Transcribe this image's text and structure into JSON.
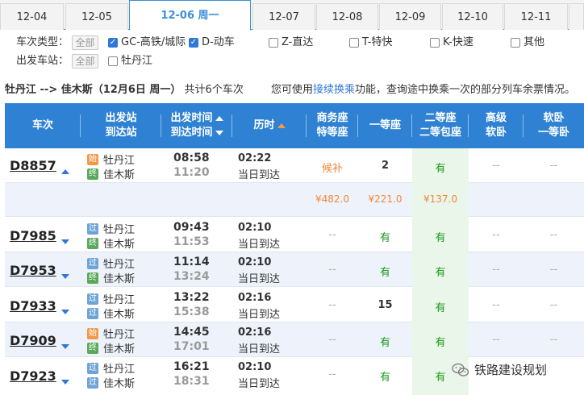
{
  "date_tabs": [
    {
      "label": "12-04"
    },
    {
      "label": "12-05"
    },
    {
      "label": "12-06 周一"
    },
    {
      "label": "12-07"
    },
    {
      "label": "12-08"
    },
    {
      "label": "12-09"
    },
    {
      "label": "12-10"
    },
    {
      "label": "12-11"
    }
  ],
  "active_tab_index": 2,
  "filters": {
    "type_label": "车次类型：",
    "all_label": "全部",
    "types": [
      {
        "label": "GC-高铁/城际",
        "checked": true
      },
      {
        "label": "D-动车",
        "checked": true
      },
      {
        "label": "Z-直达",
        "checked": false
      },
      {
        "label": "T-特快",
        "checked": false
      },
      {
        "label": "K-快速",
        "checked": false
      },
      {
        "label": "其他",
        "checked": false
      }
    ],
    "station_label": "出发车站：",
    "station_all_label": "全部",
    "stations": [
      {
        "label": "牡丹江",
        "checked": false
      }
    ]
  },
  "summary": {
    "route": "牡丹江 --> 佳木斯（12月6日 周一）",
    "count": "共计6个车次",
    "tip_prefix": "您可使用",
    "tip_link": "接续换乘",
    "tip_suffix": "功能，查询途中换乘一次的部分列车余票情况。"
  },
  "table": {
    "headers": {
      "train": "车次",
      "station_top": "出发站",
      "station_bottom": "到达站",
      "time_top": "出发时间",
      "time_bottom": "到达时间",
      "duration": "历时",
      "business_top": "商务座",
      "business_bottom": "特等座",
      "first": "一等座",
      "second_top": "二等座",
      "second_bottom": "二等包座",
      "soft_sleeper_top": "高级",
      "soft_sleeper_bottom": "软卧",
      "soft_first_top": "软卧",
      "soft_first_bottom": "一等卧"
    },
    "rows": [
      {
        "train": "D8857",
        "from_badge": "始",
        "from": "牡丹江",
        "to_badge": "终",
        "to": "佳木斯",
        "dep": "08:58",
        "arr": "11:20",
        "duration": "02:22",
        "note": "当日到达",
        "business": "候补",
        "first": "2",
        "second": "有",
        "adv_soft": "--",
        "soft_first": "--"
      },
      {
        "train": "D7985",
        "from_badge": "过",
        "from": "牡丹江",
        "to_badge": "终",
        "to": "佳木斯",
        "dep": "09:43",
        "arr": "11:53",
        "duration": "02:10",
        "note": "当日到达",
        "business": "--",
        "first": "有",
        "second": "有",
        "adv_soft": "--",
        "soft_first": "--"
      },
      {
        "train": "D7953",
        "from_badge": "过",
        "from": "牡丹江",
        "to_badge": "终",
        "to": "佳木斯",
        "dep": "11:14",
        "arr": "13:24",
        "duration": "02:10",
        "note": "当日到达",
        "business": "--",
        "first": "有",
        "second": "有",
        "adv_soft": "--",
        "soft_first": "--"
      },
      {
        "train": "D7933",
        "from_badge": "过",
        "from": "牡丹江",
        "to_badge": "过",
        "to": "佳木斯",
        "dep": "13:22",
        "arr": "15:38",
        "duration": "02:16",
        "note": "当日到达",
        "business": "--",
        "first": "15",
        "second": "有",
        "adv_soft": "--",
        "soft_first": "--"
      },
      {
        "train": "D7909",
        "from_badge": "始",
        "from": "牡丹江",
        "to_badge": "终",
        "to": "佳木斯",
        "dep": "14:45",
        "arr": "17:01",
        "duration": "02:16",
        "note": "当日到达",
        "business": "--",
        "first": "有",
        "second": "有",
        "adv_soft": "--",
        "soft_first": "--"
      },
      {
        "train": "D7923",
        "from_badge": "过",
        "from": "牡丹江",
        "to_badge": "过",
        "to": "佳木斯",
        "dep": "16:21",
        "arr": "18:31",
        "duration": "02:10",
        "note": "当日到达",
        "business": "--",
        "first": "有",
        "second": "有",
        "adv_soft": "--",
        "soft_first": "--"
      }
    ],
    "price_row": {
      "business": "¥482.0",
      "first": "¥221.0",
      "second": "¥137.0"
    }
  },
  "watermark": {
    "text": "铁路建设规划",
    "icon": "wechat-icon"
  },
  "colors": {
    "accent": "#2f82d3",
    "orange": "#f0883a",
    "green": "#1a9a1a"
  }
}
